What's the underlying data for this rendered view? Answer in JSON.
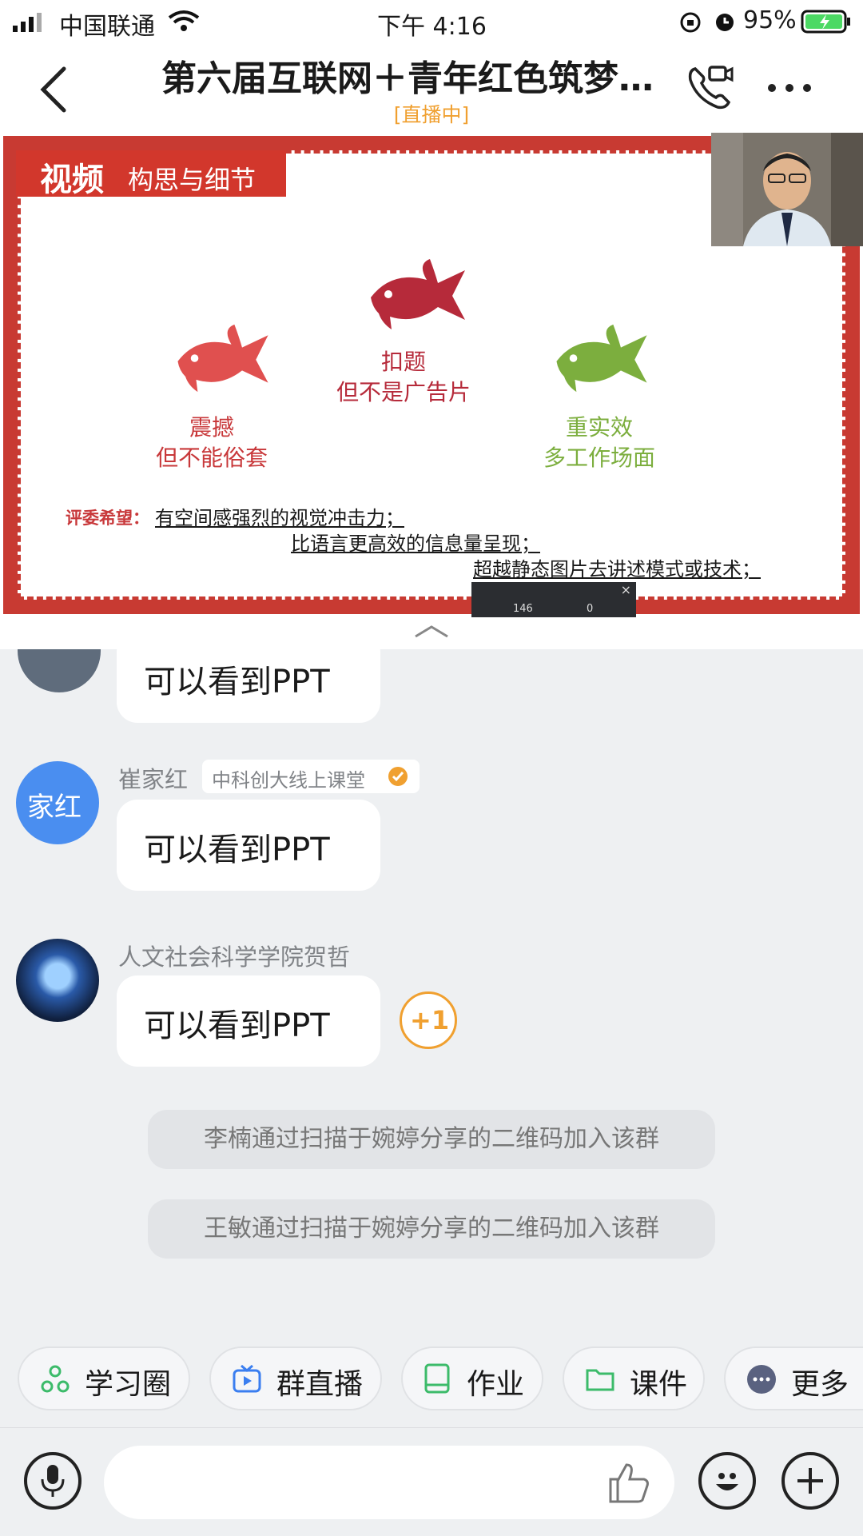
{
  "status_bar": {
    "carrier": "中国联通",
    "time": "下午 4:16",
    "battery": "95%"
  },
  "header": {
    "title": "第六届互联网＋青年红色筑梦…",
    "subtitle": "[直播中]"
  },
  "slide": {
    "tag_big": "视频",
    "tag_small": "构思与细节",
    "items": [
      {
        "label1": "扣题",
        "label2": "但不是广告片"
      },
      {
        "label1": "震撼",
        "label2": "但不能俗套"
      },
      {
        "label1": "重实效",
        "label2": "多工作场面"
      }
    ],
    "hope_label": "评委希望：",
    "hope_lines": [
      "有空间感强烈的视觉冲击力；",
      "比语言更高效的信息量呈现；",
      "超越静态图片去讲述模式或技术；"
    ],
    "mini_a": "146",
    "mini_b": "0",
    "mini_close": "×"
  },
  "messages": [
    {
      "text": "可以看到PPT"
    },
    {
      "avatar_text": "家红",
      "name": "崔家红",
      "badge": "中科创大线上课堂",
      "text": "可以看到PPT"
    },
    {
      "name": "人文社会科学学院贺哲",
      "text": "可以看到PPT",
      "plus_one": "+1"
    }
  ],
  "system_messages": [
    "李楠通过扫描于婉婷分享的二维码加入该群",
    "王敏通过扫描于婉婷分享的二维码加入该群"
  ],
  "toolbar": [
    {
      "label": "学习圈"
    },
    {
      "label": "群直播"
    },
    {
      "label": "作业"
    },
    {
      "label": "课件"
    },
    {
      "label": "更多"
    }
  ],
  "colors": {
    "accent": "#f0a030",
    "slide_red": "#c83a32",
    "fish_dark": "#b62a3a",
    "fish_light": "#e0504f",
    "fish_green": "#7cae3e"
  }
}
